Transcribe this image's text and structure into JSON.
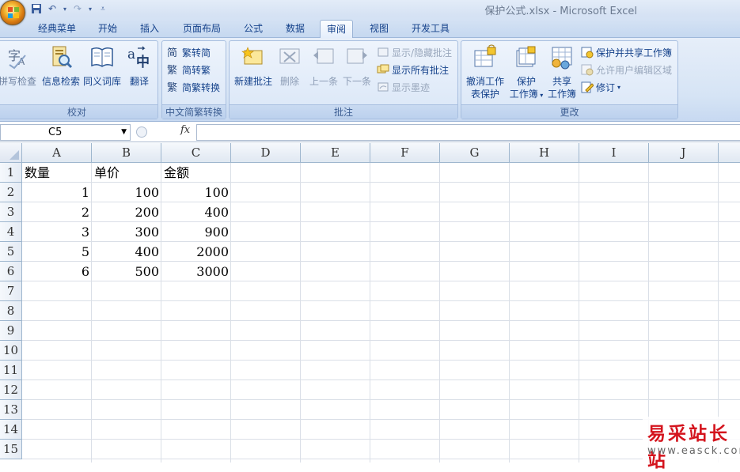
{
  "window": {
    "title": "保护公式.xlsx - Microsoft Excel"
  },
  "quick_access": {
    "icons": [
      "save-icon",
      "undo-icon",
      "redo-icon",
      "customize-icon"
    ]
  },
  "tabs": [
    {
      "label": "经典菜单"
    },
    {
      "label": "开始"
    },
    {
      "label": "插入"
    },
    {
      "label": "页面布局"
    },
    {
      "label": "公式"
    },
    {
      "label": "数据"
    },
    {
      "label": "审阅",
      "active": true
    },
    {
      "label": "视图"
    },
    {
      "label": "开发工具"
    }
  ],
  "ribbon": {
    "proofing": {
      "group_label": "校对",
      "spell": "拼写检查",
      "research": "信息检索",
      "thesaurus": "同义词库",
      "translate": "翻译"
    },
    "chinese": {
      "group_label": "中文简繁转换",
      "to_simplified": "繁转简",
      "to_traditional": "简转繁",
      "convert": "简繁转换"
    },
    "comments": {
      "group_label": "批注",
      "new": "新建批注",
      "delete": "删除",
      "previous": "上一条",
      "next": "下一条",
      "show_hide": "显示/隐藏批注",
      "show_all": "显示所有批注",
      "show_ink": "显示墨迹"
    },
    "changes": {
      "group_label": "更改",
      "unprotect_line1": "撤消工作",
      "unprotect_line2": "表保护",
      "protect_line1": "保护",
      "protect_line2": "工作簿",
      "share_line1": "共享",
      "share_line2": "工作簿",
      "protect_share": "保护并共享工作簿",
      "allow_edit": "允许用户编辑区域",
      "track": "修订"
    }
  },
  "formula_bar": {
    "name_box": "C5",
    "fx": "fx",
    "formula": ""
  },
  "sheet": {
    "columns": [
      "A",
      "B",
      "C",
      "D",
      "E",
      "F",
      "G",
      "H",
      "I",
      "J"
    ],
    "rows": [
      "1",
      "2",
      "3",
      "4",
      "5",
      "6",
      "7",
      "8",
      "9",
      "10",
      "11",
      "12",
      "13",
      "14",
      "15"
    ],
    "header": [
      "数量",
      "单价",
      "金额"
    ],
    "data": [
      [
        "1",
        "100",
        "100"
      ],
      [
        "2",
        "200",
        "400"
      ],
      [
        "3",
        "300",
        "900"
      ],
      [
        "5",
        "400",
        "2000"
      ],
      [
        "6",
        "500",
        "3000"
      ]
    ]
  },
  "watermark": {
    "line1": "易采站长站",
    "line2": "www.easck.com"
  }
}
